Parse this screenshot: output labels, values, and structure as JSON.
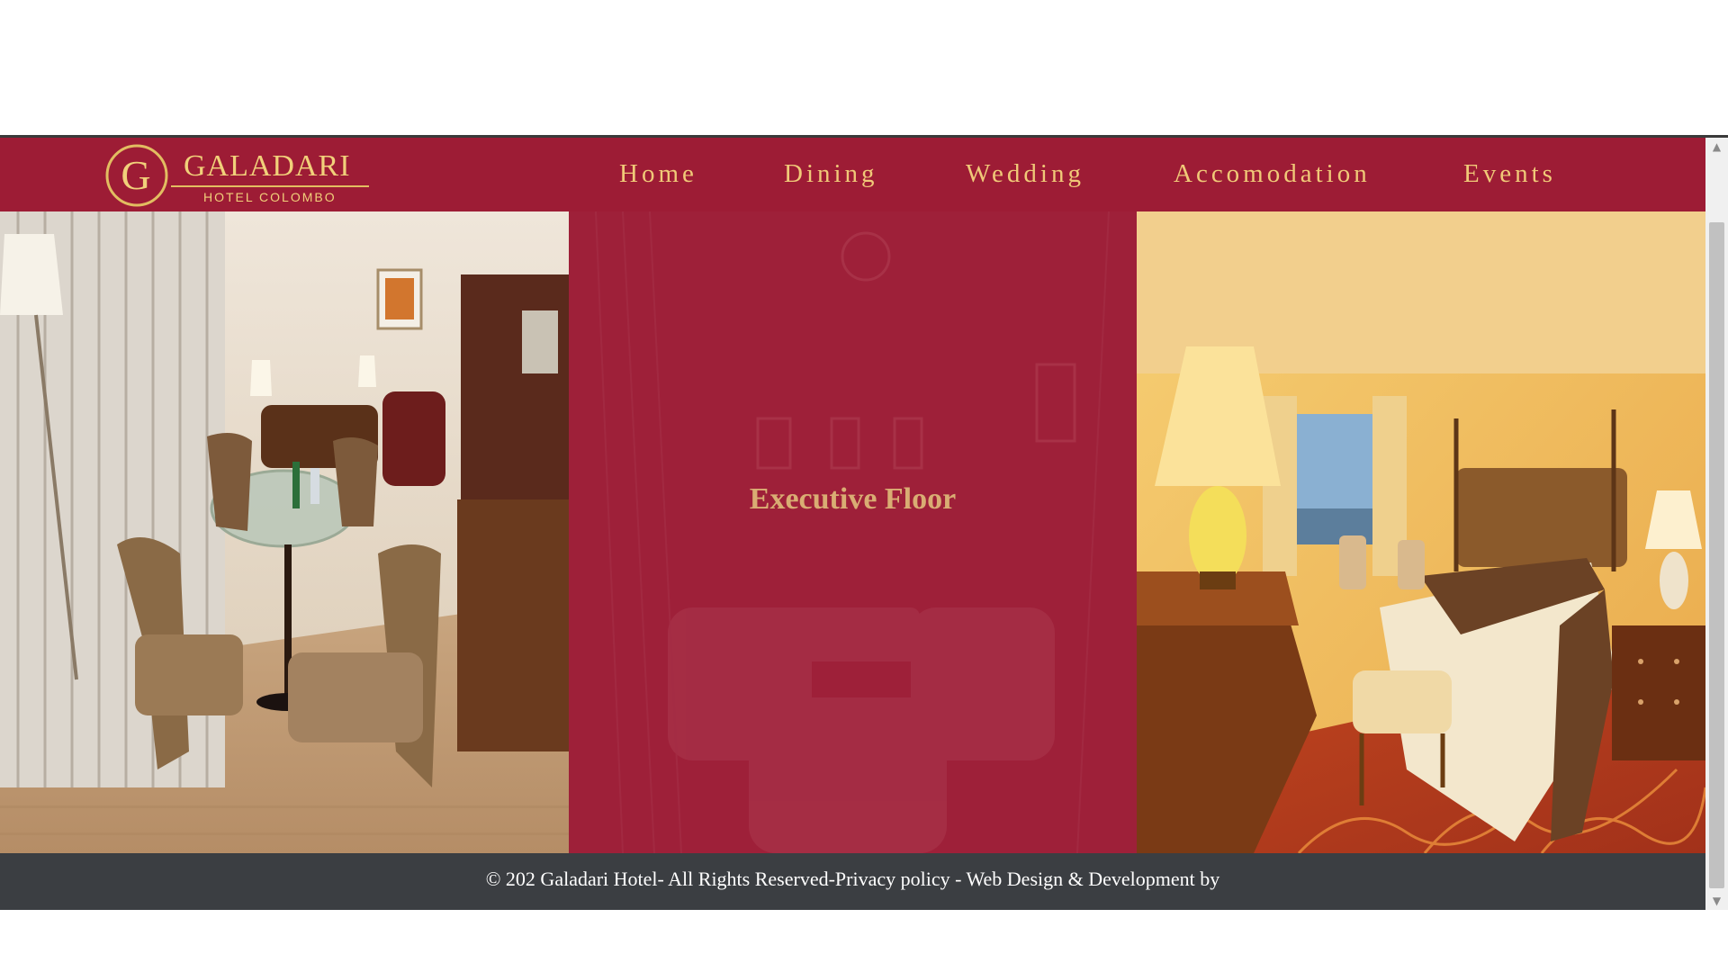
{
  "brand": {
    "logo_letter": "G",
    "name": "GALADARI",
    "subtitle": "HOTEL COLOMBO",
    "gold": "#f1d07a"
  },
  "nav": {
    "items": [
      {
        "label": "Home"
      },
      {
        "label": "Dining"
      },
      {
        "label": "Wedding"
      },
      {
        "label": "Accomodation"
      },
      {
        "label": "Events"
      }
    ]
  },
  "panels": {
    "middle_title": "Executive Floor"
  },
  "footer": {
    "text": "© 202 Galadari Hotel- All Rights Reserved-Privacy policy - Web Design & Development by"
  },
  "colors": {
    "brand_red": "#9d1c35",
    "footer_bg": "#3b3e42",
    "nav_text": "#f0c978"
  },
  "scrollbar": {
    "up_icon": "triangle-up",
    "down_icon": "triangle-down"
  }
}
